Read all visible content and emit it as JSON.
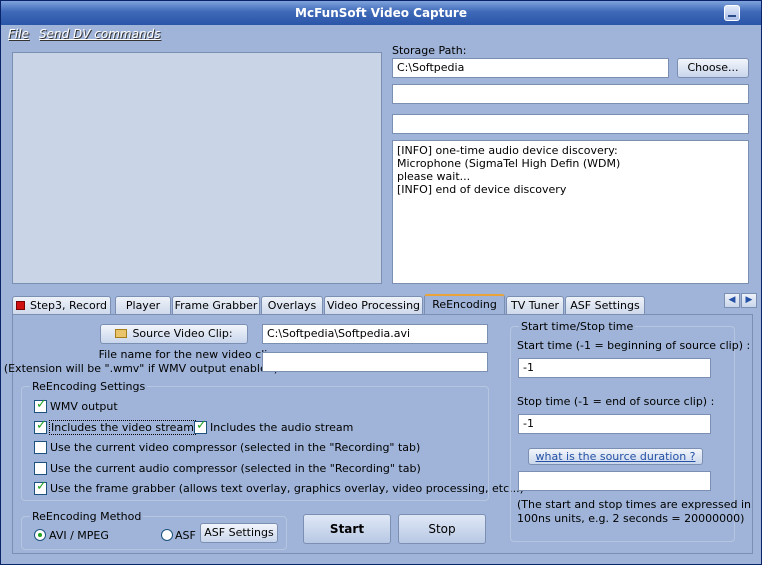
{
  "window": {
    "title": "McFunSoft Video Capture"
  },
  "menu": {
    "file": "File",
    "send_dv": "Send DV commands"
  },
  "storage": {
    "label": "Storage Path:",
    "path": "C:\\Softpedia",
    "choose_label": "Choose...",
    "field2": "",
    "field3": ""
  },
  "log": {
    "lines": [
      "[INFO] one-time audio device discovery:",
      "Microphone (SigmaTel High Defin (WDM)",
      "please wait...",
      "[INFO] end of device discovery"
    ]
  },
  "tabs": [
    {
      "label": "Step3, Record"
    },
    {
      "label": "Player"
    },
    {
      "label": "Frame Grabber"
    },
    {
      "label": "Overlays"
    },
    {
      "label": "Video Processing"
    },
    {
      "label": "ReEncoding"
    },
    {
      "label": "TV Tuner"
    },
    {
      "label": "ASF Settings"
    }
  ],
  "active_tab": "ReEncoding",
  "reencoding": {
    "source_button": "Source Video Clip:",
    "source_path": "C:\\Softpedia\\Softpedia.avi",
    "new_name_label1": "File name for the new video clip:",
    "new_name_label2": "(Extension will be \".wmv\" if WMV output enabled)",
    "new_name_value": "",
    "settings_title": "ReEncoding Settings",
    "wmv_output": {
      "label": "WMV output",
      "checked": true
    },
    "include_video": {
      "label": "Includes the video stream",
      "checked": true
    },
    "include_audio": {
      "label": "Includes the audio stream",
      "checked": true
    },
    "video_compressor": {
      "label": "Use the current video compressor (selected in the \"Recording\" tab)",
      "checked": false
    },
    "audio_compressor": {
      "label": "Use the current audio compressor (selected in the \"Recording\" tab)",
      "checked": false
    },
    "frame_grabber": {
      "label": "Use the frame grabber (allows text overlay, graphics overlay, video processing, etc...)",
      "checked": true
    },
    "method_title": "ReEncoding Method",
    "method_avi": "AVI / MPEG",
    "method_asf": "ASF",
    "method_selected": "AVI / MPEG",
    "asf_settings_button": "ASF Settings",
    "start_button": "Start",
    "stop_button": "Stop"
  },
  "times": {
    "group_title": "Start time/Stop time",
    "start_label": "Start time (-1 = beginning of source clip) :",
    "start_value": "-1",
    "stop_label": "Stop time (-1 = end of source clip) :",
    "stop_value": "-1",
    "duration_button": "what is the source duration ?",
    "duration_value": "",
    "note_line1": "(The start and stop times are expressed in",
    "note_line2": "100ns units, e.g. 2 seconds = 20000000)"
  },
  "colors": {
    "accent_tab": "#e8a33a",
    "check": "#21a121",
    "record": "#d01010"
  }
}
